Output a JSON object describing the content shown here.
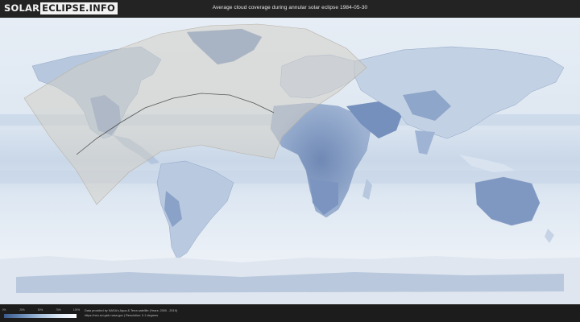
{
  "header": {
    "logo_left": "SOLAR",
    "logo_right": "ECLIPSE.INFO",
    "title": "Average cloud coverage during annular solar eclipse 1984-05-30"
  },
  "legend": {
    "ticks": [
      "0%",
      "25%",
      "50%",
      "75%",
      "100%"
    ],
    "colors": [
      "#3a5a8c",
      "#6a8ab8",
      "#a7bfdc",
      "#dce7f3",
      "#ffffff"
    ]
  },
  "footer": {
    "credit_line1": "Data provided by NASA's Aqua & Terra satellite (Years: 2000 - 2019)",
    "credit_line2": "https://neo.sci.gsfc.nasa.gov | Resolution: 0.1 degrees"
  },
  "map": {
    "content": "world cloud-coverage map with eclipse visibility zone and central path",
    "colors": {
      "ocean": "#d6e1ee",
      "clear_sky": "#7f99c2",
      "cloudy": "#f1f5fa",
      "eclipse_zone": "#cfcac0",
      "path_line": "#555555"
    }
  }
}
